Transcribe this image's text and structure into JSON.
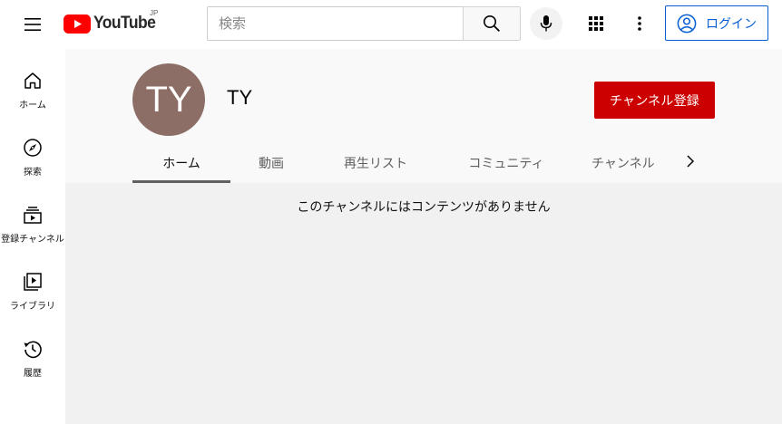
{
  "header": {
    "logo_text": "YouTube",
    "region": "JP",
    "search_placeholder": "検索",
    "login_label": "ログイン"
  },
  "sidebar": {
    "items": [
      {
        "label": "ホーム",
        "icon": "home-icon"
      },
      {
        "label": "探索",
        "icon": "compass-icon"
      },
      {
        "label": "登録チャンネル",
        "icon": "subscriptions-icon"
      },
      {
        "label": "ライブラリ",
        "icon": "library-icon"
      },
      {
        "label": "履歴",
        "icon": "history-icon"
      }
    ]
  },
  "channel": {
    "avatar_initials": "TY",
    "avatar_color": "#8c6e66",
    "name": "TY",
    "subscribe_label": "チャンネル登録",
    "tabs": [
      {
        "label": "ホーム",
        "active": true
      },
      {
        "label": "動画",
        "active": false
      },
      {
        "label": "再生リスト",
        "active": false
      },
      {
        "label": "コミュニティ",
        "active": false
      },
      {
        "label": "チャンネル",
        "active": false
      }
    ]
  },
  "content": {
    "empty_message": "このチャンネルにはコンテンツがありません"
  },
  "colors": {
    "brand_red": "#ff0000",
    "subscribe_red": "#cc0000",
    "link_blue": "#065fd4"
  }
}
